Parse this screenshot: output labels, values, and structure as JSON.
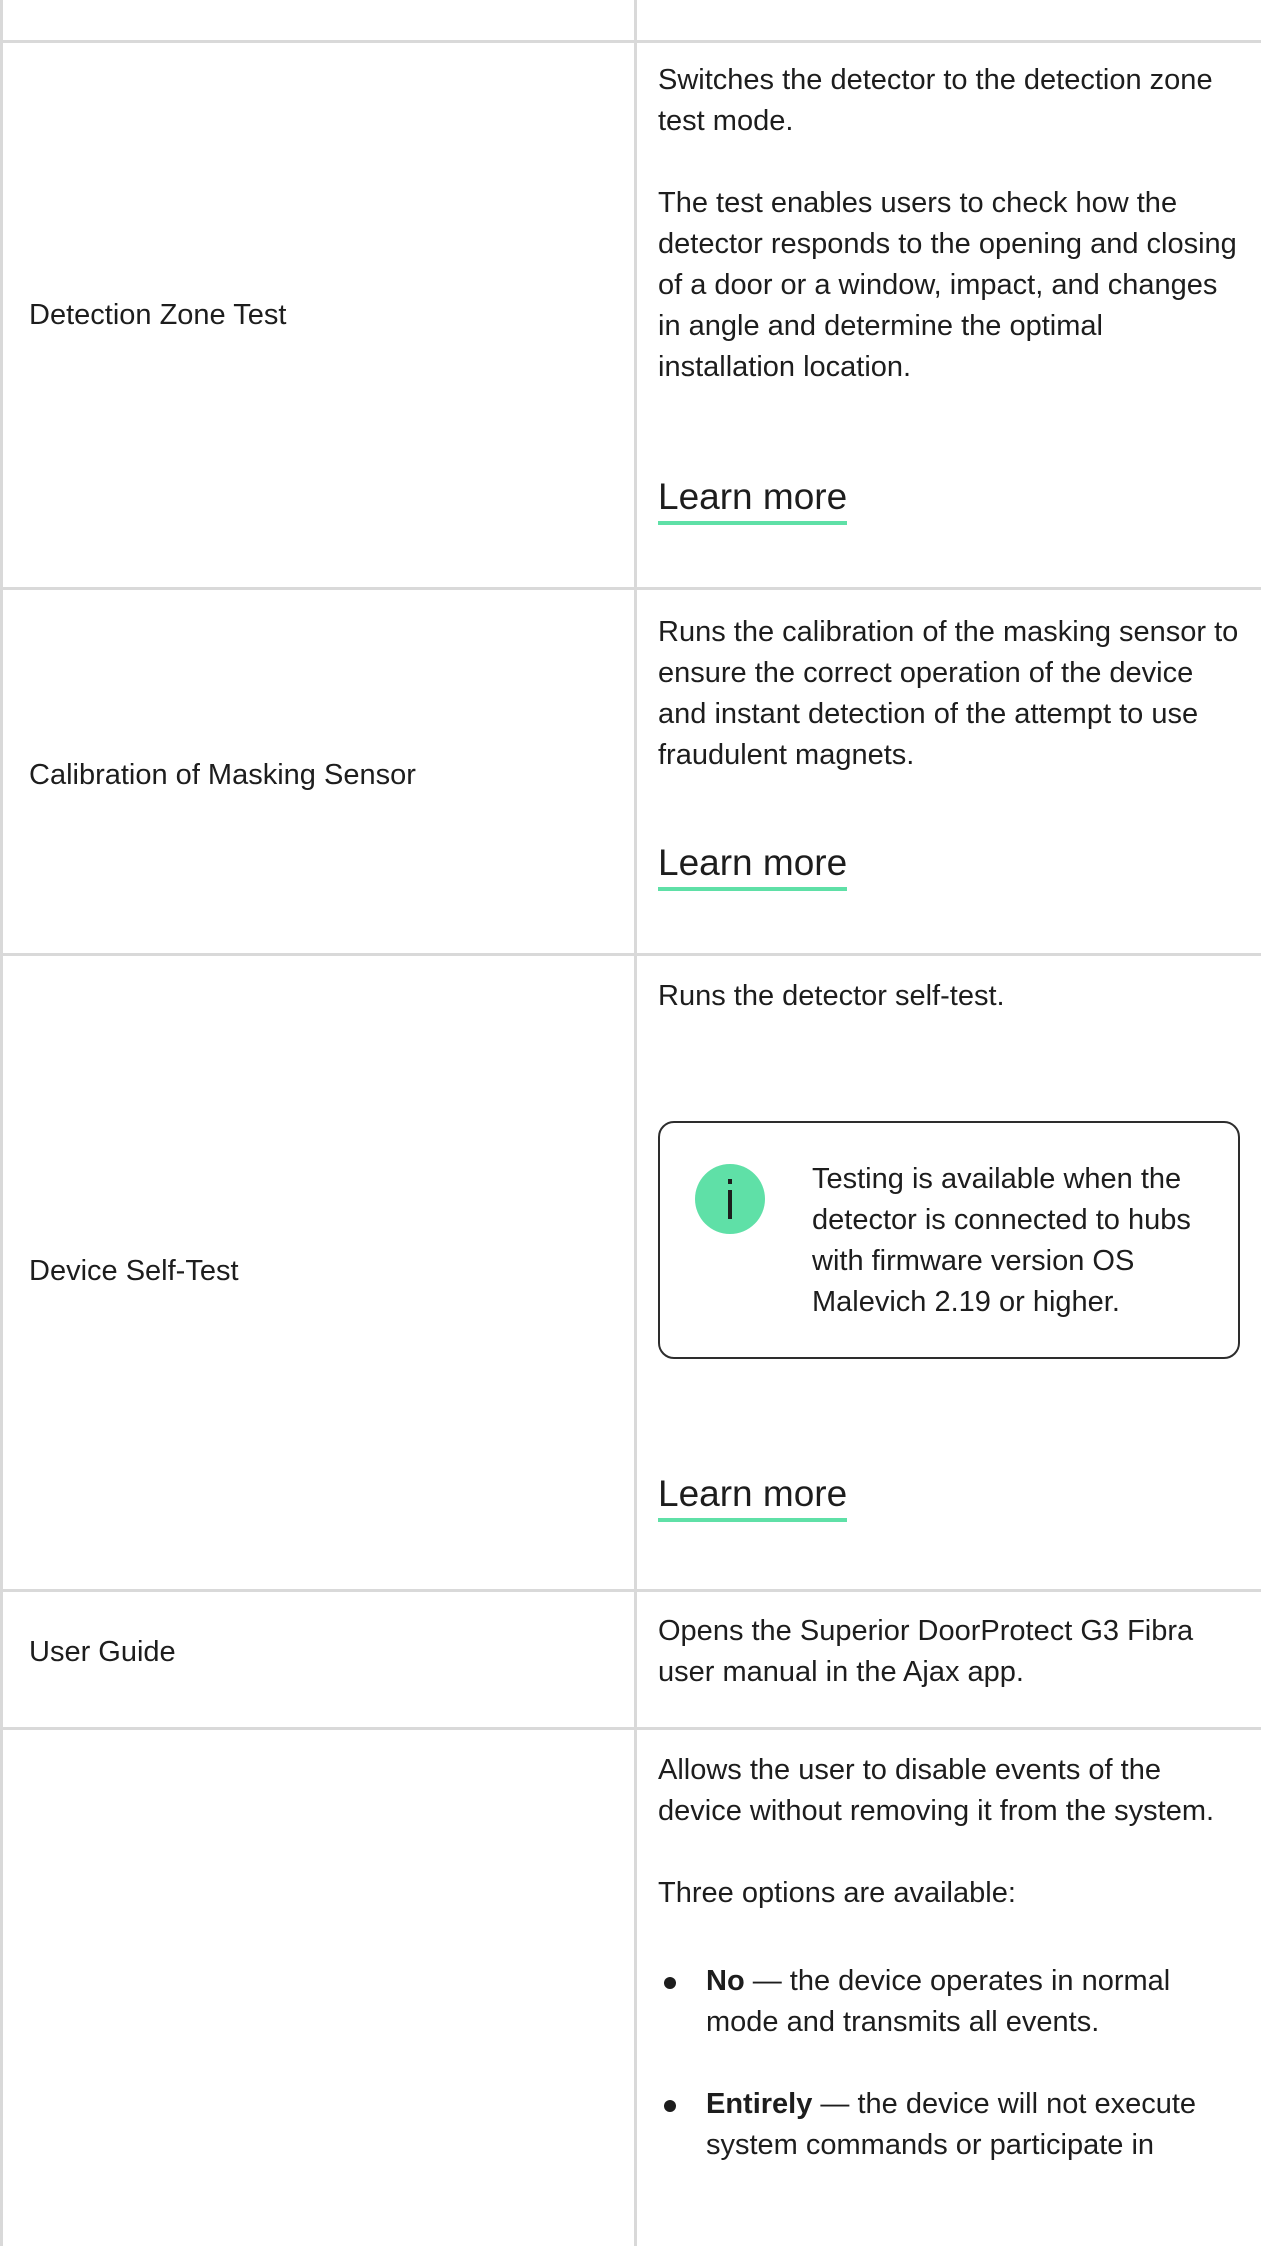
{
  "rows": [
    {
      "name": "Detection Zone Test",
      "paragraphs": [
        "Switches the detector to the detection zone test mode.",
        "The test enables users to check how the detector responds to the opening and closing of a door or a window, impact, and changes in angle and determine the optimal installation location."
      ],
      "link": "Learn more"
    },
    {
      "name": "Calibration of Masking Sensor",
      "paragraphs": [
        "Runs the calibration of the masking sensor to ensure the correct operation of the device and instant detection of the attempt to use fraudulent magnets."
      ],
      "link": "Learn more"
    },
    {
      "name": "Device Self-Test",
      "paragraphs": [
        "Runs the detector self-test."
      ],
      "note": {
        "icon": "info-icon",
        "text": "Testing is available when the detector is connected to hubs with firmware version OS Malevich 2.19 or higher."
      },
      "link": "Learn more"
    },
    {
      "name": "User Guide",
      "paragraphs": [
        "Opens the Superior DoorProtect G3 Fibra user manual in the Ajax app."
      ]
    },
    {
      "name": "",
      "paragraphs": [
        "Allows the user to disable events of the device without removing it from the system.",
        "Three options are available:"
      ],
      "options": [
        {
          "term": "No",
          "text": " — the device operates in normal mode and transmits all events."
        },
        {
          "term": "Entirely",
          "text": " — the device will not execute system commands or participate in"
        }
      ]
    }
  ],
  "colors": {
    "accent": "#5fe0a7",
    "grid": "#d9d9d9",
    "text": "#1d1d1d"
  }
}
